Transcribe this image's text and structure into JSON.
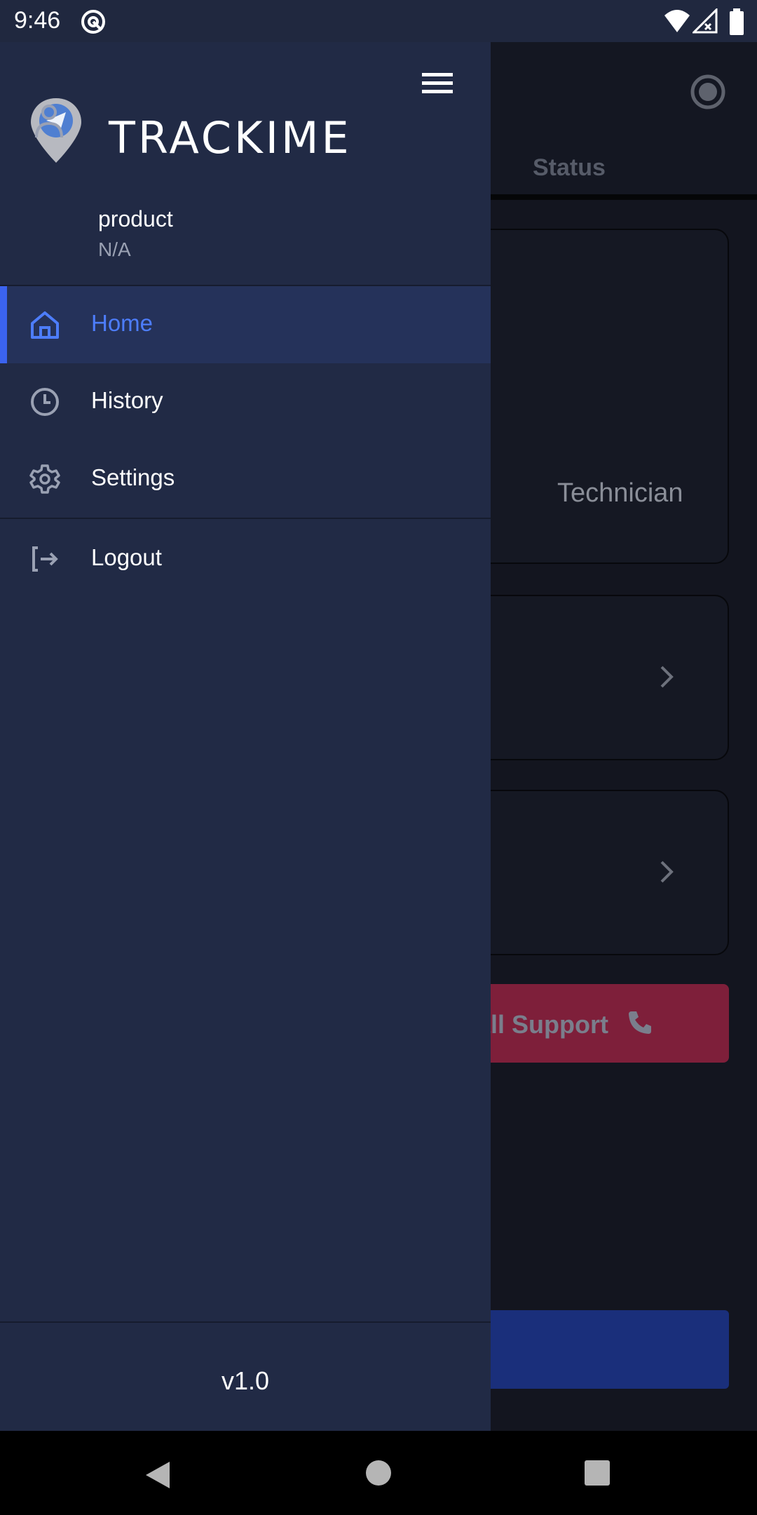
{
  "status_bar": {
    "time": "9:46",
    "icons": [
      "at-sign-icon",
      "wifi-icon",
      "signal-off-icon",
      "battery-icon"
    ]
  },
  "background_app": {
    "tab_label": "Status",
    "card_role_text": "Technician",
    "support_button_label": "all Support",
    "icons": [
      "record-icon",
      "chevron-right-icon",
      "phone-icon"
    ]
  },
  "drawer": {
    "logo_text": "TRACKIME",
    "menu_icon": "hamburger-menu-icon",
    "user": {
      "name": "product",
      "subtitle": "N/A"
    },
    "nav_items": [
      {
        "label": "Home",
        "icon": "home-icon",
        "active": true
      },
      {
        "label": "History",
        "icon": "clock-icon",
        "active": false
      },
      {
        "label": "Settings",
        "icon": "gear-icon",
        "active": false
      },
      {
        "label": "Logout",
        "icon": "logout-icon",
        "active": false
      }
    ],
    "version": "v1.0"
  },
  "colors": {
    "drawer_bg": "#212a45",
    "active_accent": "#3b63f0",
    "active_label": "#4d7dfb",
    "support_button": "#7e1f3a",
    "primary_button": "#1a2f7b"
  },
  "nav_bar": {
    "icons": [
      "back-icon",
      "home-circle-icon",
      "recents-icon"
    ]
  }
}
